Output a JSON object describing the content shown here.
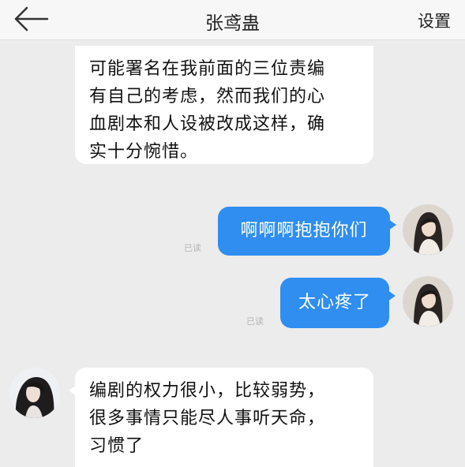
{
  "header": {
    "title": "张鸢蛊",
    "settings_label": "设置"
  },
  "messages": [
    {
      "side": "in",
      "lines": [
        "可能署名在我前面的三位责编",
        "有自己的考虑，然而我们的心",
        "血剧本和人设被改成这样，确",
        "实十分惋惜。"
      ]
    },
    {
      "side": "out",
      "text": "啊啊啊抱抱你们",
      "status": "已读"
    },
    {
      "side": "out",
      "text": "太心疼了",
      "status": "已读"
    },
    {
      "side": "in",
      "lines": [
        "编剧的权力很小，比较弱势，",
        "很多事情只能尽人事听天命，",
        "习惯了"
      ]
    }
  ],
  "colors": {
    "background": "#ececec",
    "outgoing_bubble": "#2f8ef0",
    "incoming_bubble": "#ffffff"
  }
}
